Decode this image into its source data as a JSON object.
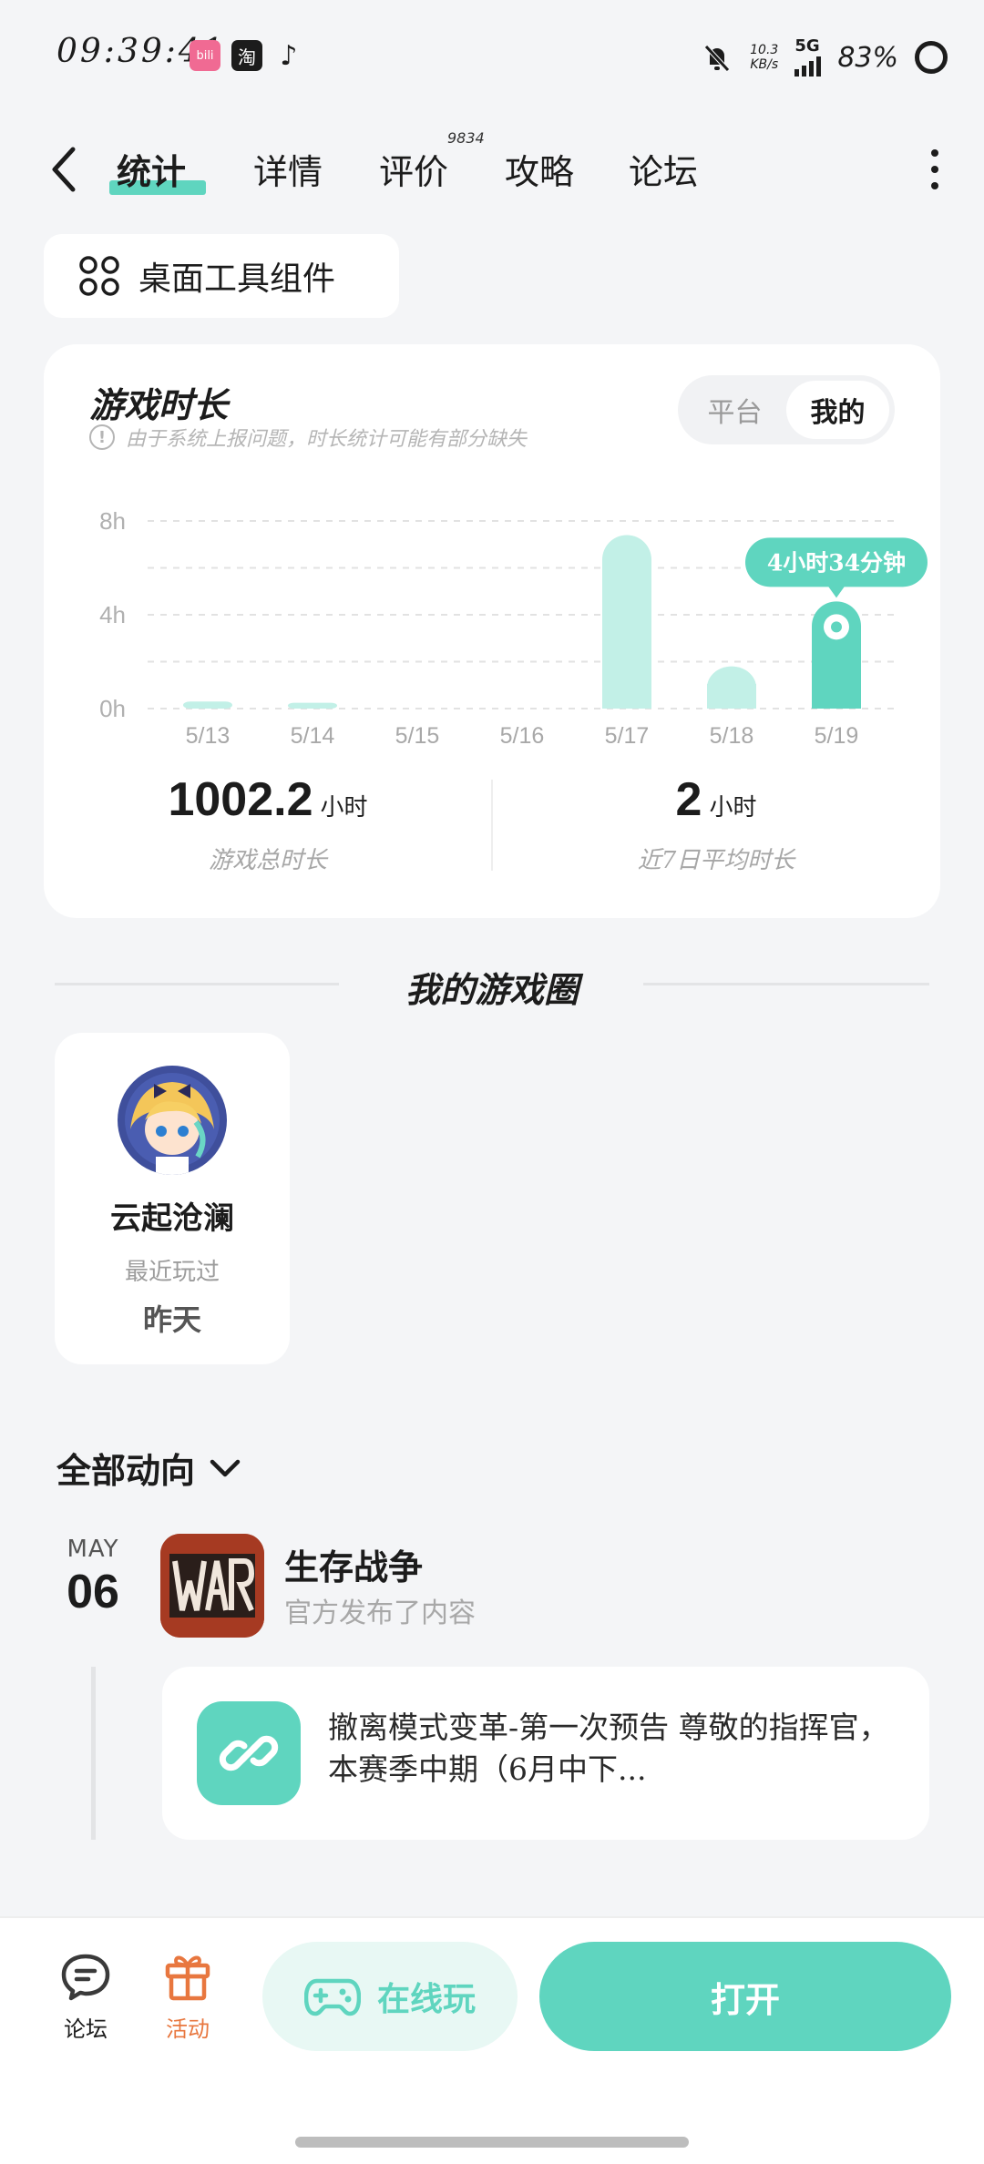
{
  "status_bar": {
    "time": "09:39:41",
    "net_speed_value": "10.3",
    "net_speed_unit": "KB/s",
    "network": "5G",
    "battery": "83%"
  },
  "nav": {
    "tabs": [
      {
        "label": "统计",
        "active": true
      },
      {
        "label": "详情",
        "active": false
      },
      {
        "label": "评价",
        "active": false,
        "count": "9834"
      },
      {
        "label": "攻略",
        "active": false
      },
      {
        "label": "论坛",
        "active": false
      }
    ]
  },
  "widget_button": {
    "label": "桌面工具组件"
  },
  "playtime_card": {
    "title": "游戏时长",
    "note": "由于系统上报问题，时长统计可能有部分缺失",
    "toggle": {
      "options": [
        "平台",
        "我的"
      ],
      "selected": "我的"
    },
    "tooltip": "4小时34分钟",
    "total": {
      "value": "1002.2",
      "unit": "小时",
      "label": "游戏总时长"
    },
    "average": {
      "value": "2",
      "unit": "小时",
      "label": "近7日平均时长"
    }
  },
  "chart_data": {
    "type": "bar",
    "categories": [
      "5/13",
      "5/14",
      "5/15",
      "5/16",
      "5/17",
      "5/18",
      "5/19"
    ],
    "values": [
      0.3,
      0.25,
      0,
      0,
      7.4,
      1.8,
      4.57
    ],
    "y_ticks": [
      "0h",
      "4h",
      "8h"
    ],
    "ylim": [
      0,
      8
    ],
    "highlight_index": 6,
    "grid": true,
    "colors": {
      "bar": "#c2f0e7",
      "highlight": "#5fd5bf"
    }
  },
  "game_circle": {
    "section_title": "我的游戏圈",
    "items": [
      {
        "name": "云起沧澜",
        "sub": "最近玩过",
        "when": "昨天"
      }
    ]
  },
  "activity": {
    "filter_label": "全部动向",
    "items": [
      {
        "month": "MAY",
        "day": "06",
        "game": "生存战争",
        "action": "官方发布了内容",
        "post_text": "撤离模式变革-第一次预告 尊敬的指挥官， 本赛季中期（6月中下..."
      }
    ]
  },
  "bottom_bar": {
    "forum_label": "论坛",
    "events_label": "活动",
    "play_online_label": "在线玩",
    "open_label": "打开"
  },
  "colors": {
    "accent": "#5fd5bf",
    "events": "#e8773f",
    "background": "#f4f5f7"
  }
}
